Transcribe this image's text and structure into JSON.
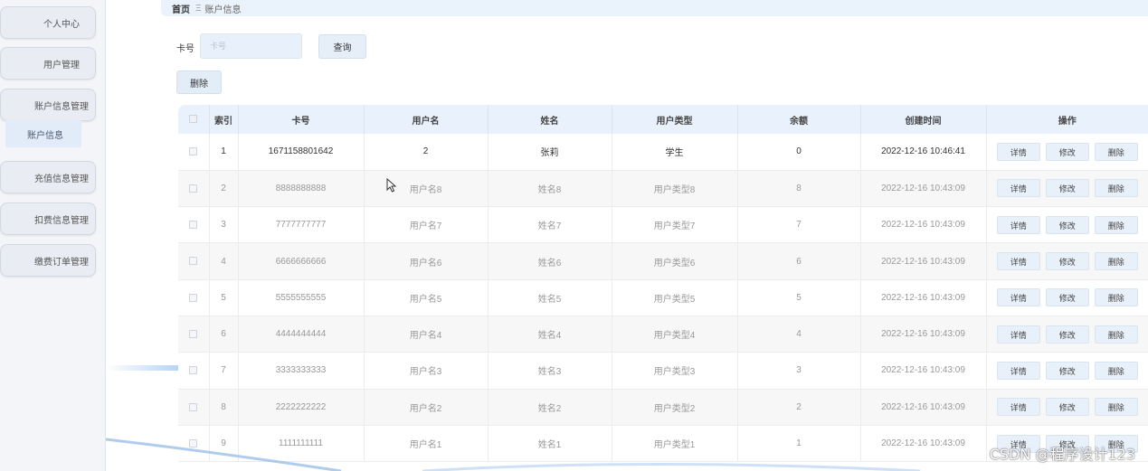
{
  "sidebar": {
    "items": [
      {
        "label": "个人中心"
      },
      {
        "label": "用户管理"
      },
      {
        "label": "账户信息管理"
      },
      {
        "label": "充值信息管理"
      },
      {
        "label": "扣费信息管理"
      },
      {
        "label": "缴费订单管理"
      }
    ],
    "sub_item": {
      "label": "账户信息"
    }
  },
  "breadcrumb": {
    "home": "首页",
    "separator": "Ξ",
    "current": "账户信息"
  },
  "search": {
    "label": "卡号",
    "placeholder": "卡号",
    "query_button": "查询"
  },
  "toolbar": {
    "delete_label": "删除"
  },
  "table": {
    "headers": [
      "索引",
      "卡号",
      "用户名",
      "姓名",
      "用户类型",
      "余额",
      "创建时间",
      "操作"
    ],
    "rows": [
      {
        "index": "1",
        "card": "1671158801642",
        "username": "2",
        "name": "张莉",
        "type": "学生",
        "balance": "0",
        "created": "2022-12-16 10:46:41"
      },
      {
        "index": "2",
        "card": "8888888888",
        "username": "用户名8",
        "name": "姓名8",
        "type": "用户类型8",
        "balance": "8",
        "created": "2022-12-16 10:43:09"
      },
      {
        "index": "3",
        "card": "7777777777",
        "username": "用户名7",
        "name": "姓名7",
        "type": "用户类型7",
        "balance": "7",
        "created": "2022-12-16 10:43:09"
      },
      {
        "index": "4",
        "card": "6666666666",
        "username": "用户名6",
        "name": "姓名6",
        "type": "用户类型6",
        "balance": "6",
        "created": "2022-12-16 10:43:09"
      },
      {
        "index": "5",
        "card": "5555555555",
        "username": "用户名5",
        "name": "姓名5",
        "type": "用户类型5",
        "balance": "5",
        "created": "2022-12-16 10:43:09"
      },
      {
        "index": "6",
        "card": "4444444444",
        "username": "用户名4",
        "name": "姓名4",
        "type": "用户类型4",
        "balance": "4",
        "created": "2022-12-16 10:43:09"
      },
      {
        "index": "7",
        "card": "3333333333",
        "username": "用户名3",
        "name": "姓名3",
        "type": "用户类型3",
        "balance": "3",
        "created": "2022-12-16 10:43:09"
      },
      {
        "index": "8",
        "card": "2222222222",
        "username": "用户名2",
        "name": "姓名2",
        "type": "用户类型2",
        "balance": "2",
        "created": "2022-12-16 10:43:09"
      },
      {
        "index": "9",
        "card": "1111111111",
        "username": "用户名1",
        "name": "姓名1",
        "type": "用户类型1",
        "balance": "1",
        "created": "2022-12-16 10:43:09"
      }
    ],
    "actions": {
      "detail": "详情",
      "edit": "修改",
      "delete": "删除"
    }
  },
  "watermark": "CSDN @程序设计123",
  "icons": {
    "cursor": "mouse-pointer-icon",
    "checkbox": "checkbox-icon"
  },
  "colors": {
    "header_bg": "#e8f1fc",
    "sidebar_bg": "#f3f5f8",
    "button_bg": "#e8f0fa"
  }
}
